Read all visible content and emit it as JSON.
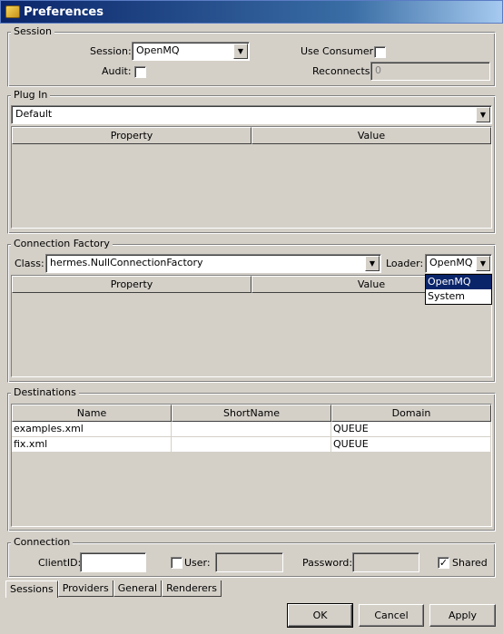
{
  "window": {
    "title": "Preferences"
  },
  "session": {
    "legend": "Session",
    "session_label": "Session:",
    "session_value": "OpenMQ",
    "use_consumer_label": "Use Consumer:",
    "use_consumer_checked": false,
    "audit_label": "Audit:",
    "audit_checked": false,
    "reconnects_label": "Reconnects:",
    "reconnects_value": "0"
  },
  "plugin": {
    "legend": "Plug In",
    "selected": "Default",
    "columns": [
      "Property",
      "Value"
    ]
  },
  "connection_factory": {
    "legend": "Connection Factory",
    "class_label": "Class:",
    "class_value": "hermes.NullConnectionFactory",
    "loader_label": "Loader:",
    "loader_value": "OpenMQ",
    "loader_options": [
      "OpenMQ",
      "System"
    ],
    "columns": [
      "Property",
      "Value"
    ]
  },
  "destinations": {
    "legend": "Destinations",
    "columns": [
      "Name",
      "ShortName",
      "Domain"
    ],
    "rows": [
      [
        "examples.xml",
        "",
        "QUEUE"
      ],
      [
        "fix.xml",
        "",
        "QUEUE"
      ]
    ]
  },
  "connection": {
    "legend": "Connection",
    "clientid_label": "ClientID:",
    "clientid_value": "",
    "user_label": "User:",
    "user_checked": false,
    "user_value": "",
    "password_label": "Password:",
    "password_value": "",
    "shared_label": "Shared",
    "shared_checked": true
  },
  "tabs": [
    "Sessions",
    "Providers",
    "General",
    "Renderers"
  ],
  "buttons": {
    "ok": "OK",
    "cancel": "Cancel",
    "apply": "Apply"
  },
  "icons": {
    "title": "app-icon",
    "combo": "chevron-down-icon",
    "check": "check-icon"
  }
}
